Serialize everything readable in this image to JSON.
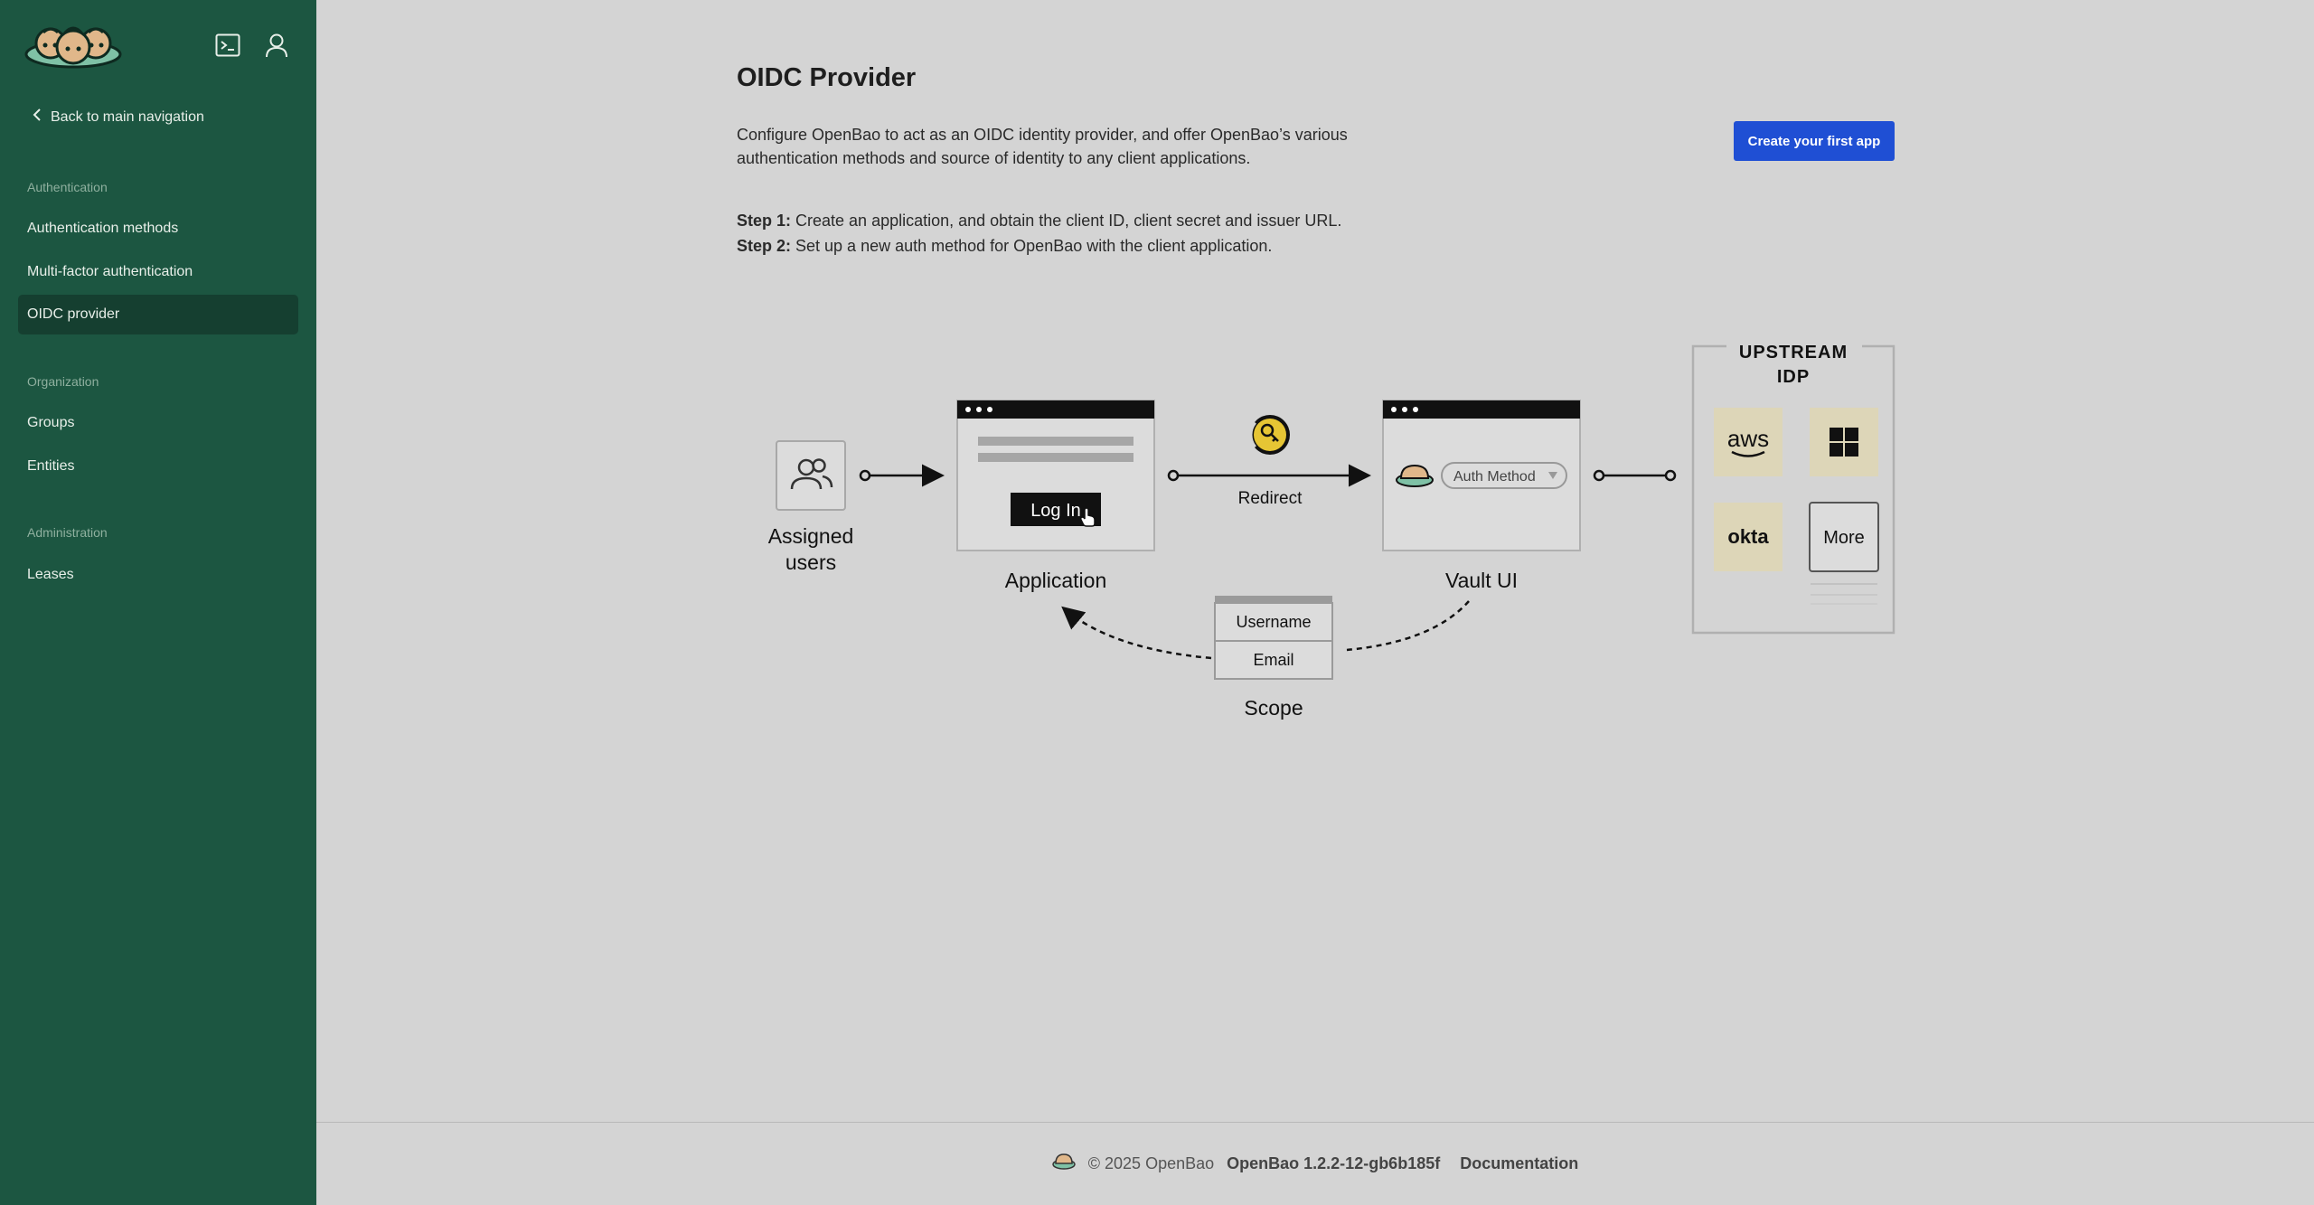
{
  "sidebar": {
    "back_label": "Back to main navigation",
    "sections": {
      "authentication": "Authentication",
      "organization": "Organization",
      "administration": "Administration"
    },
    "items": {
      "auth_methods": "Authentication methods",
      "mfa": "Multi-factor authentication",
      "oidc": "OIDC provider",
      "groups": "Groups",
      "entities": "Entities",
      "leases": "Leases"
    },
    "active_item": "OIDC provider"
  },
  "main": {
    "title": "OIDC Provider",
    "description": "Configure OpenBao to act as an OIDC identity provider, and offer OpenBao’s various authentication methods and source of identity to any client applications.",
    "create_button": "Create your first app",
    "steps": [
      {
        "label": "Step 1:",
        "text": " Create an application, and obtain the client ID, client secret and issuer URL."
      },
      {
        "label": "Step 2:",
        "text": " Set up a new auth method for OpenBao with the client application."
      }
    ]
  },
  "diagram": {
    "assigned_users_line1": "Assigned",
    "assigned_users_line2": "users",
    "login_button": "Log In",
    "application": "Application",
    "redirect": "Redirect",
    "auth_method": "Auth Method",
    "vault_ui": "Vault UI",
    "scope_items": [
      "Username",
      "Email"
    ],
    "scope": "Scope",
    "upstream_line1": "UPSTREAM",
    "upstream_line2": "IDP",
    "idp_aws": "aws",
    "idp_okta": "okta",
    "idp_more": "More"
  },
  "footer": {
    "copyright": "© 2025 OpenBao",
    "version": "OpenBao 1.2.2-12-gb6b185f",
    "documentation": "Documentation"
  },
  "colors": {
    "sidebar_bg": "#1c5641",
    "sidebar_active": "#153f30",
    "main_bg": "#d4d4d4",
    "primary_button": "#1f4fd4",
    "idp_tile": "#ddd6b8",
    "key_badge": "#e6c534"
  }
}
